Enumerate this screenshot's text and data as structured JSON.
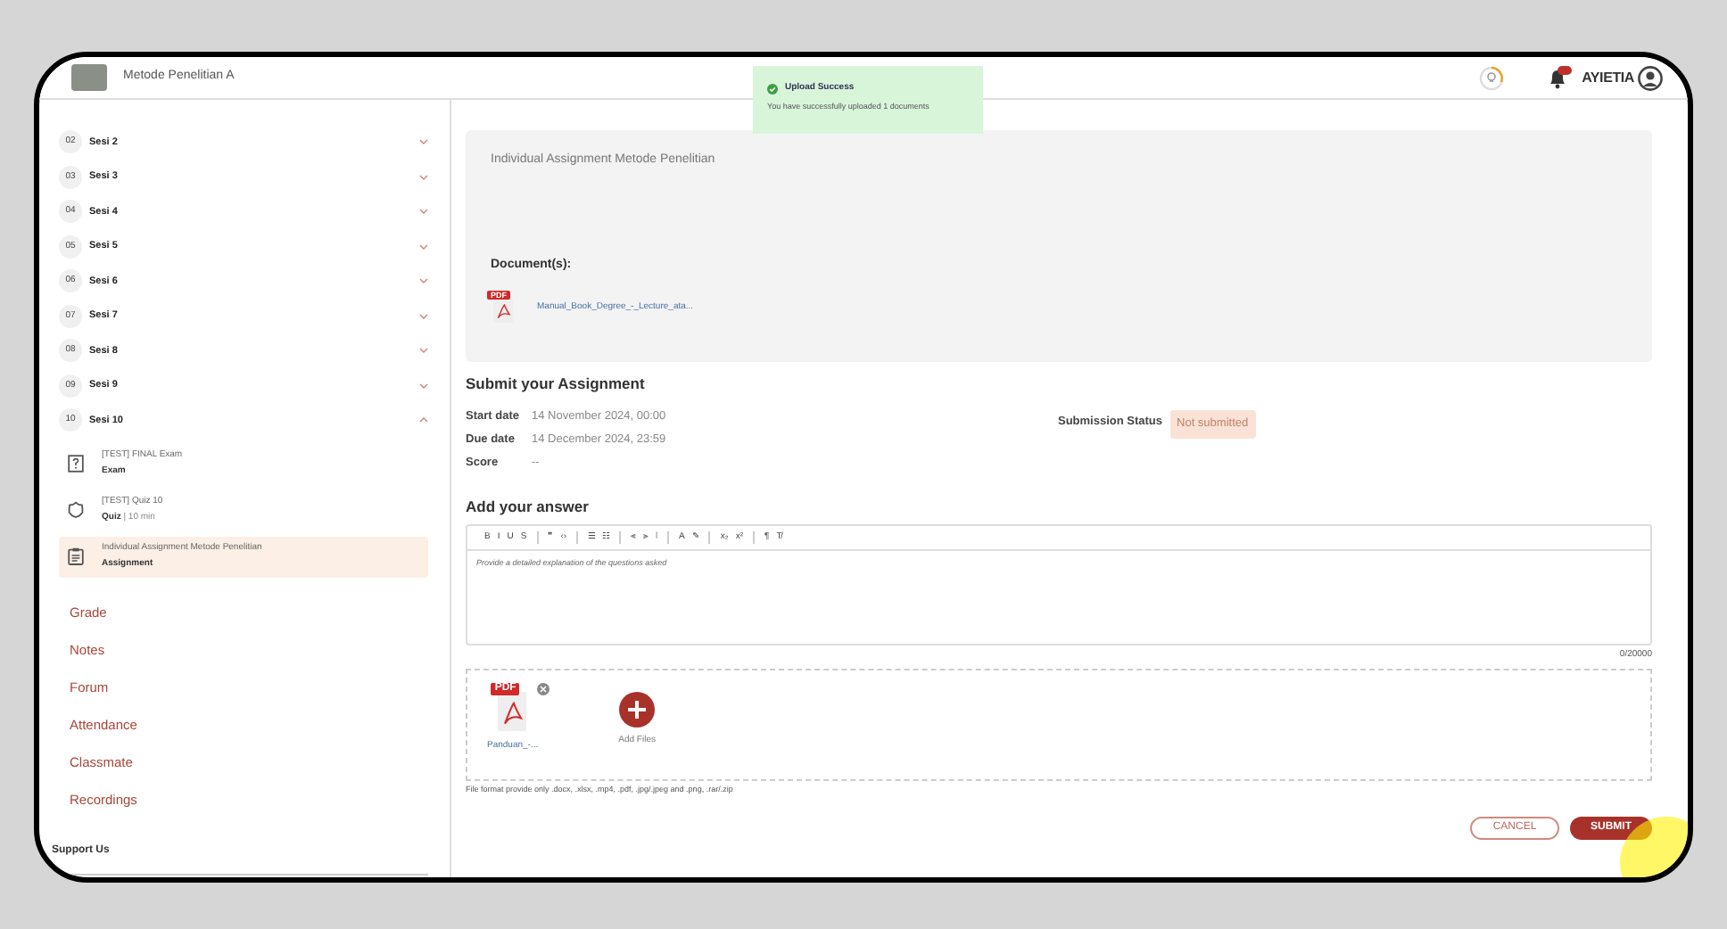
{
  "header": {
    "course_title": "Metode Penelitian A",
    "user_name": "AYIETIA"
  },
  "toast": {
    "title": "Upload Success",
    "message": "You have successfully uploaded 1 documents"
  },
  "sidebar": {
    "sessions": [
      {
        "number": "02",
        "label": "Sesi 2",
        "expanded": false
      },
      {
        "number": "03",
        "label": "Sesi 3",
        "expanded": false
      },
      {
        "number": "04",
        "label": "Sesi 4",
        "expanded": false
      },
      {
        "number": "05",
        "label": "Sesi 5",
        "expanded": false
      },
      {
        "number": "06",
        "label": "Sesi 6",
        "expanded": false
      },
      {
        "number": "07",
        "label": "Sesi 7",
        "expanded": false
      },
      {
        "number": "08",
        "label": "Sesi 8",
        "expanded": false
      },
      {
        "number": "09",
        "label": "Sesi 9",
        "expanded": false
      },
      {
        "number": "10",
        "label": "Sesi 10",
        "expanded": true,
        "children": [
          {
            "kind": "exam",
            "title": "[TEST] FINAL Exam",
            "type_label": "Exam",
            "selected": false
          },
          {
            "kind": "quiz",
            "title": "[TEST] Quiz 10",
            "type_label": "Quiz",
            "detail": " | 10 min",
            "selected": false
          },
          {
            "kind": "assignment",
            "title": "Individual Assignment Metode Penelitian",
            "type_label": "Assignment",
            "selected": true
          }
        ]
      }
    ],
    "links": [
      "Grade",
      "Notes",
      "Forum",
      "Attendance",
      "Classmate",
      "Recordings"
    ],
    "footer_heading": "Support Us"
  },
  "assignment": {
    "description": "Individual Assignment Metode Penelitian",
    "documents_label": "Document(s):",
    "documents": [
      {
        "name": "Manual_Book_Degree_-_Lecture_ata...",
        "file_badge": "PDF"
      }
    ]
  },
  "submit": {
    "heading": "Submit your Assignment",
    "details": [
      {
        "label": "Start date",
        "value": "14 November 2024, 00:00"
      },
      {
        "label": "Due date",
        "value": "14 December 2024, 23:59"
      },
      {
        "label": "Score",
        "value": "--"
      }
    ],
    "status_label": "Submission Status",
    "status_value": "Not submitted",
    "answer_heading": "Add your answer",
    "toolbar": [
      [
        "B",
        "I",
        "U",
        "S"
      ],
      [
        "❞",
        "‹›"
      ],
      [
        "☰",
        "☷"
      ],
      [
        "⫷",
        "⫸",
        "⦚"
      ],
      [
        "A",
        "✎"
      ],
      [
        "x₂",
        "x²"
      ],
      [
        "¶",
        "T̸"
      ]
    ],
    "editor_placeholder": "Provide a detailed explanation of the questions asked",
    "char_count": "0/20000",
    "files": [
      {
        "name": "Panduan_-...",
        "file_badge": "PDF"
      }
    ],
    "add_files_label": "Add Files",
    "format_note": "File format provide only .docx, .xlsx, .mp4, .pdf, .jpg/.jpeg and .png, .rar/.zip",
    "buttons": [
      {
        "kind": "secondary",
        "label": "CANCEL"
      },
      {
        "kind": "primary",
        "label": "SUBMIT"
      }
    ]
  }
}
